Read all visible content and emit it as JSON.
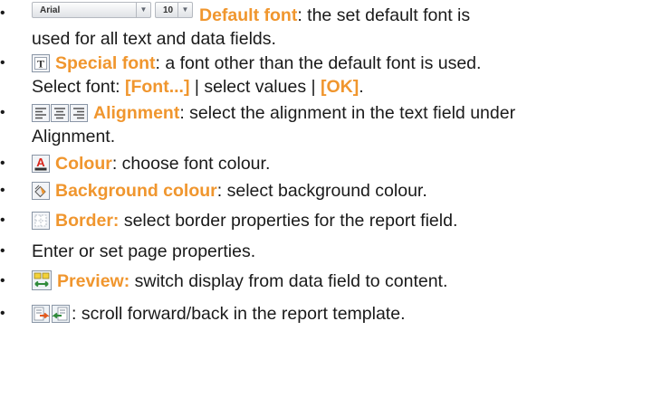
{
  "items": [
    {
      "icon": "font-toolbar-icon",
      "toolbar": {
        "font_name": "Arial",
        "font_size": "10"
      },
      "keyword": "Default font",
      "lines": [
        ": the set default font is",
        "used for all text and data fields."
      ]
    },
    {
      "icon": "special-font-icon",
      "keyword": "Special font",
      "lines": [
        ": a font other than the default font is used."
      ],
      "line2_prefix": "Select font: ",
      "line2_kw1": "[Font...]",
      "line2_mid": " | select values | ",
      "line2_kw2": "[OK]",
      "line2_end": "."
    },
    {
      "icon": "alignment-icons",
      "keyword": "Alignment",
      "lines": [
        ": select the alignment in the text field under",
        "Alignment."
      ]
    },
    {
      "icon": "font-colour-icon",
      "keyword": "Colour",
      "lines": [
        ": choose font colour."
      ]
    },
    {
      "icon": "background-colour-icon",
      "keyword": "Background colour",
      "lines": [
        ": select background colour."
      ]
    },
    {
      "icon": "border-icon",
      "keyword": "Border:",
      "lines": [
        " select border properties for the report field."
      ]
    },
    {
      "lines": [
        "Enter or set page properties."
      ]
    },
    {
      "icon": "preview-icon",
      "keyword": "Preview:",
      "lines": [
        " switch display from data field to content."
      ]
    },
    {
      "icon": "scroll-forward-back-icons",
      "lines": [
        ": scroll forward/back in the report template."
      ]
    }
  ],
  "bullet_char": "•",
  "colors": {
    "keyword": "#f0962e",
    "text": "#1a1a1a",
    "icon_border": "#8a96a6",
    "font_colour_red": "#d9261c"
  }
}
